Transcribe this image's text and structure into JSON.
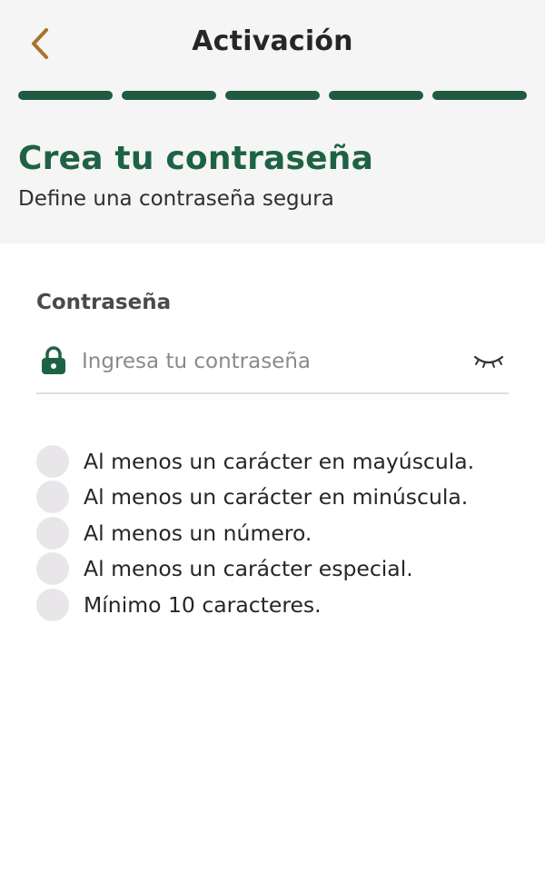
{
  "header": {
    "title": "Activación",
    "back_icon": "chevron-left-icon"
  },
  "colors": {
    "accent_green": "#1e6244",
    "progress_green": "#1f5a41",
    "back_gold": "#a8742a",
    "top_background": "#f5f5f5",
    "check_gray": "#e8e6e9"
  },
  "progress": {
    "total_steps": 5,
    "completed_steps": 5
  },
  "page": {
    "title": "Crea tu contraseña",
    "subtitle": "Define una contraseña segura"
  },
  "password_field": {
    "label": "Contraseña",
    "placeholder": "Ingresa tu contraseña",
    "value": "",
    "lock_icon": "lock-icon",
    "visibility_icon": "eye-closed-icon"
  },
  "requirements": [
    {
      "text": "Al menos un carácter en mayúscula.",
      "met": false
    },
    {
      "text": "Al menos un carácter en minúscula.",
      "met": false
    },
    {
      "text": "Al menos un número.",
      "met": false
    },
    {
      "text": "Al menos un carácter especial.",
      "met": false
    },
    {
      "text": "Mínimo 10 caracteres.",
      "met": false
    }
  ]
}
